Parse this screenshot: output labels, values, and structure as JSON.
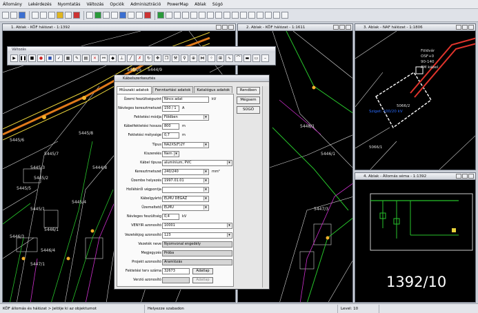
{
  "menu": [
    "Állomány",
    "Lekérdezés",
    "Nyomtatás",
    "Változás",
    "Opciók",
    "Adminisztráció",
    "PowerMap",
    "Ablak",
    "Súgó"
  ],
  "windows": {
    "w1": "1. Ablak - KÖF hálózat - 1:1392",
    "w2": "2. Ablak - KÖF hálózat - 1:1611",
    "w3": "3. Ablak - NAF hálózat - 1:1806",
    "w4": "4. Ablak - Állomás séma - 1:1392"
  },
  "map_labels": {
    "w1": [
      "5446/2",
      "5446/5",
      "5445/7",
      "5445/6",
      "5445/5",
      "5445/8",
      "5444/9",
      "5445/3",
      "5445/2",
      "5445/1",
      "5444/8",
      "5445/4",
      "5446/1",
      "5446/3",
      "5446/4",
      "5447/1"
    ],
    "w2": [
      "5446/1",
      "5447/3",
      "5448/1"
    ],
    "w3": [
      "Földvár",
      "OSF+0",
      "90-140",
      "ÁM kábel",
      "5066/2",
      "5066/1",
      "Sziget: 100/20 kV"
    ],
    "w4_caption": "1392/10"
  },
  "palette": {
    "title": "Változás"
  },
  "dialog": {
    "title": "Kábelszerkesztés",
    "tabs": [
      "Műszaki adatok",
      "Fenntartási adatok",
      "Katalógus adatok"
    ],
    "buttons": {
      "ok": "Rendben",
      "cancel": "Mégsem",
      "help": "SÚGÓ"
    },
    "fields": [
      {
        "label": "Üzemi feszültségszint",
        "value": "Nincs adat",
        "unit": "kV",
        "type": "text"
      },
      {
        "label": "Névleges keresztmetszet",
        "value": "150 / 1",
        "unit": "A",
        "type": "text",
        "narrow": true
      },
      {
        "label": "Fektetési módja",
        "value": "Földben",
        "type": "select"
      },
      {
        "label": "Kábelfektetési hossza",
        "value": "800",
        "unit": "m",
        "type": "text",
        "narrow": true
      },
      {
        "label": "Fektetési mélysége",
        "value": "0,7",
        "unit": "m",
        "type": "text",
        "narrow": true
      },
      {
        "label": "Típus",
        "value": "NA2XS(F)2Y",
        "type": "select"
      },
      {
        "label": "Kiszerelés",
        "value": "Nem",
        "type": "select",
        "narrow": true
      },
      {
        "label": "Kábel típusa",
        "value": "alumínium, PVC",
        "type": "select",
        "wide": true
      },
      {
        "label": "Keresztmetszet",
        "value": "240/240",
        "unit": "mm²",
        "type": "select"
      },
      {
        "label": "Üzembe helyezés",
        "value": "1997.01.01",
        "type": "select"
      },
      {
        "label": "Hollétéről végpontja",
        "value": "",
        "type": "select"
      },
      {
        "label": "Kábelgyártó",
        "value": "ELMŰ DÉGÁZ",
        "type": "select"
      },
      {
        "label": "Üzemeltető",
        "value": "ELMŰ",
        "type": "select"
      },
      {
        "label": "Névleges feszültség",
        "value": "0,4",
        "unit": "kV",
        "type": "text",
        "narrow": true
      },
      {
        "label": "VENYIR azonosító",
        "value": "10001",
        "type": "select",
        "wide": true
      },
      {
        "label": "Vezetékjog azonosító",
        "value": "123",
        "type": "select",
        "wide": true
      },
      {
        "label": "Vezeték neve",
        "value": "Nyomvonal engedély",
        "type": "text",
        "wide": true,
        "disabled": true
      },
      {
        "label": "Megjegyzés",
        "value": "Próba",
        "type": "text",
        "wide": true,
        "disabled": true
      },
      {
        "label": "Projekt azonosító",
        "value": "Aramlózás",
        "type": "text",
        "wide": true,
        "disabled": true
      },
      {
        "label": "Fektetési terv száma",
        "value": "32673",
        "type": "button",
        "button": "Adatlap"
      },
      {
        "label": "Verzió azonosító",
        "value": "",
        "type": "button",
        "button": "Adatlap",
        "disabled": true
      }
    ]
  },
  "status": {
    "left": "KÖF állomás és hálózat > Jelölje ki az objektumot",
    "middle": "Helyezze szabadon",
    "right": "Level: 10"
  }
}
